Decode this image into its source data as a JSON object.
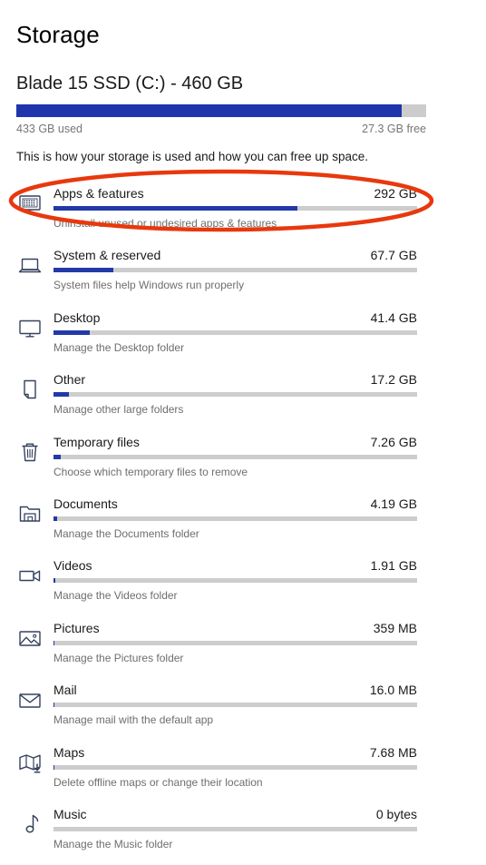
{
  "header": {
    "page_title": "Storage",
    "drive_title": "Blade 15 SSD (C:) - 460 GB",
    "used_label": "433 GB used",
    "free_label": "27.3 GB free",
    "intro_text": "This is how your storage is used and how you can free up space.",
    "drive_used_percent": 94,
    "bar_fill_color": "#1f35ab",
    "bar_track_color": "#cccccc"
  },
  "annotation": {
    "shape": "ellipse-highlight",
    "color": "#e8380d",
    "target": "Apps & features"
  },
  "categories": [
    {
      "icon": "apps-monitor-icon",
      "name": "Apps & features",
      "size": "292 GB",
      "description": "Uninstall unused or undesired apps & features",
      "bar_percent": 67
    },
    {
      "icon": "laptop-icon",
      "name": "System & reserved",
      "size": "67.7 GB",
      "description": "System files help Windows run properly",
      "bar_percent": 16.5
    },
    {
      "icon": "monitor-icon",
      "name": "Desktop",
      "size": "41.4 GB",
      "description": "Manage the Desktop folder",
      "bar_percent": 10
    },
    {
      "icon": "page-curl-icon",
      "name": "Other",
      "size": "17.2 GB",
      "description": "Manage other large folders",
      "bar_percent": 4.2
    },
    {
      "icon": "trash-icon",
      "name": "Temporary files",
      "size": "7.26 GB",
      "description": "Choose which temporary files to remove",
      "bar_percent": 1.9
    },
    {
      "icon": "documents-folder-icon",
      "name": "Documents",
      "size": "4.19 GB",
      "description": "Manage the Documents folder",
      "bar_percent": 1.1
    },
    {
      "icon": "video-camera-icon",
      "name": "Videos",
      "size": "1.91 GB",
      "description": "Manage the Videos folder",
      "bar_percent": 0.6
    },
    {
      "icon": "picture-icon",
      "name": "Pictures",
      "size": "359 MB",
      "description": "Manage the Pictures folder",
      "bar_percent": 0.3
    },
    {
      "icon": "envelope-icon",
      "name": "Mail",
      "size": "16.0 MB",
      "description": "Manage mail with the default app",
      "bar_percent": 0.15
    },
    {
      "icon": "map-download-icon",
      "name": "Maps",
      "size": "7.68 MB",
      "description": "Delete offline maps or change their location",
      "bar_percent": 0.1
    },
    {
      "icon": "music-note-icon",
      "name": "Music",
      "size": "0 bytes",
      "description": "Manage the Music folder",
      "bar_percent": 0
    }
  ]
}
